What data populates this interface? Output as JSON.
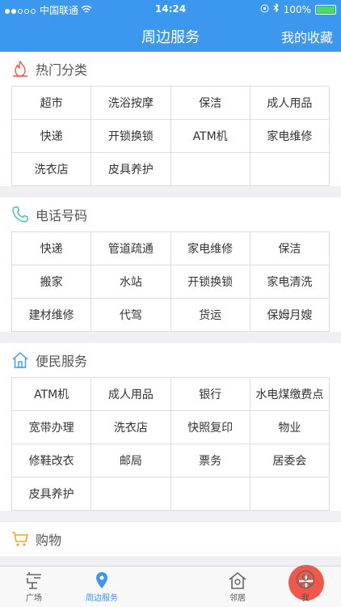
{
  "status_bar": {
    "carrier": "中国联通",
    "time": "14:24",
    "battery": "100%"
  },
  "nav": {
    "title": "周边服务",
    "right_action": "我的收藏"
  },
  "sections": [
    {
      "title": "热门分类",
      "icon": "fire-icon",
      "icon_color": "#f2584a",
      "items": [
        "超市",
        "洗浴按摩",
        "保洁",
        "成人用品",
        "快递",
        "开锁换锁",
        "ATM机",
        "家电维修",
        "洗衣店",
        "皮具养护",
        "",
        ""
      ]
    },
    {
      "title": "电话号码",
      "icon": "phone-icon",
      "icon_color": "#3cc0b0",
      "items": [
        "快递",
        "管道疏通",
        "家电维修",
        "保洁",
        "搬家",
        "水站",
        "开锁换锁",
        "家电清洗",
        "建材维修",
        "代驾",
        "货运",
        "保姆月嫂"
      ]
    },
    {
      "title": "便民服务",
      "icon": "house-icon",
      "icon_color": "#3c97ef",
      "items": [
        "ATM机",
        "成人用品",
        "银行",
        "水电煤缴费点",
        "宽带办理",
        "洗衣店",
        "快照复印",
        "物业",
        "修鞋改衣",
        "邮局",
        "票务",
        "居委会",
        "皮具养护",
        "",
        "",
        ""
      ]
    },
    {
      "title": "购物",
      "icon": "cart-icon",
      "icon_color": "#f5a623",
      "items": []
    }
  ],
  "tab_bar": {
    "tabs": [
      {
        "label": "广场",
        "icon": "plaza-icon"
      },
      {
        "label": "周边服务",
        "icon": "location-pin-icon"
      },
      {
        "label": "",
        "icon": "plus-icon"
      },
      {
        "label": "邻居",
        "icon": "neighbor-icon"
      },
      {
        "label": "我",
        "icon": "profile-icon"
      }
    ],
    "active_index": 1
  },
  "colors": {
    "primary": "#3c97ef",
    "accent": "#f2584a"
  }
}
